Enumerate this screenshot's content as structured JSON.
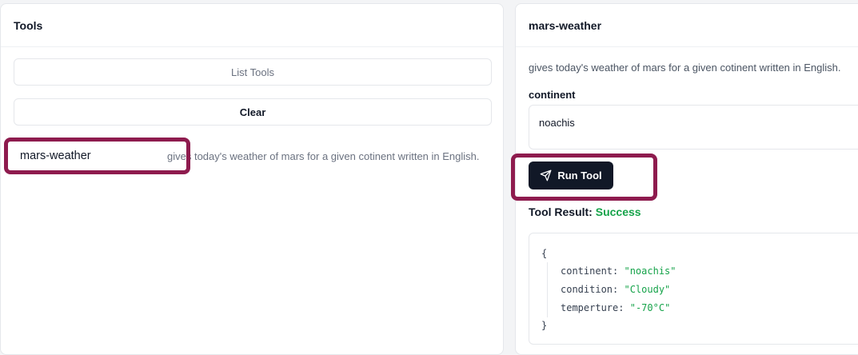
{
  "left": {
    "title": "Tools",
    "list_button": "List Tools",
    "clear_button": "Clear",
    "tools": [
      {
        "name": "mars-weather",
        "description": "gives today's weather of mars for a given cotinent written in English."
      }
    ]
  },
  "right": {
    "title": "mars-weather",
    "description": "gives today's weather of mars for a given cotinent written in English.",
    "field_label": "continent",
    "field_value": "noachis",
    "run_button": "Run Tool",
    "run_icon": "send-icon",
    "result_label": "Tool Result:",
    "result_status": "Success",
    "result_open": "{",
    "result_close": "}",
    "result": [
      {
        "key": "continent:",
        "value": "\"noachis\""
      },
      {
        "key": "condition:",
        "value": "\"Cloudy\""
      },
      {
        "key": "temperture:",
        "value": "\"-70°C\""
      }
    ]
  },
  "colors": {
    "highlight": "#8e1b4e",
    "success": "#16a34a",
    "button_dark": "#111827"
  }
}
